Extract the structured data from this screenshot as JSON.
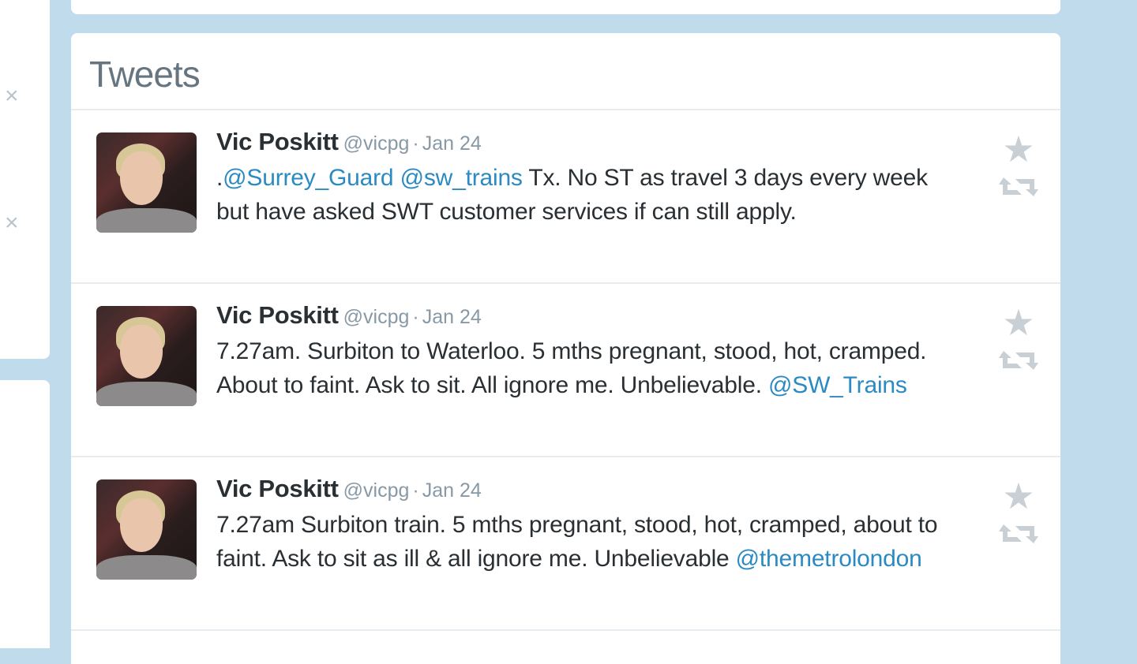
{
  "left_panel": {
    "dismiss_glyph": "×"
  },
  "header": {
    "title": "Tweets"
  },
  "icons": {
    "favorite": "star-icon",
    "retweet": "retweet-icon",
    "dismiss": "close-icon"
  },
  "colors": {
    "link": "#2b8ac2",
    "page_background": "#c0dbeb",
    "text": "#292f33",
    "muted": "#8899a6"
  },
  "tweets": [
    {
      "name": "Vic Poskitt",
      "handle": "@vicpg",
      "sep": "·",
      "time": "Jan 24",
      "segments": [
        {
          "text": ".",
          "type": "text"
        },
        {
          "text": "@Surrey_Guard",
          "type": "mention"
        },
        {
          "text": " ",
          "type": "text"
        },
        {
          "text": "@sw_trains",
          "type": "mention"
        },
        {
          "text": " Tx. No ST as travel 3 days every week but have asked SWT customer services if can still apply.",
          "type": "text"
        }
      ]
    },
    {
      "name": "Vic Poskitt",
      "handle": "@vicpg",
      "sep": "·",
      "time": "Jan 24",
      "segments": [
        {
          "text": "7.27am. Surbiton to Waterloo. 5 mths pregnant, stood, hot, cramped. About to faint. Ask to sit. All ignore me. Unbelievable. ",
          "type": "text"
        },
        {
          "text": "@SW_Trains",
          "type": "mention"
        }
      ]
    },
    {
      "name": "Vic Poskitt",
      "handle": "@vicpg",
      "sep": "·",
      "time": "Jan 24",
      "segments": [
        {
          "text": "7.27am Surbiton train. 5 mths pregnant, stood, hot, cramped, about to faint. Ask to sit as ill & all ignore me. Unbelievable ",
          "type": "text"
        },
        {
          "text": "@themetrolondon",
          "type": "mention"
        }
      ]
    }
  ]
}
